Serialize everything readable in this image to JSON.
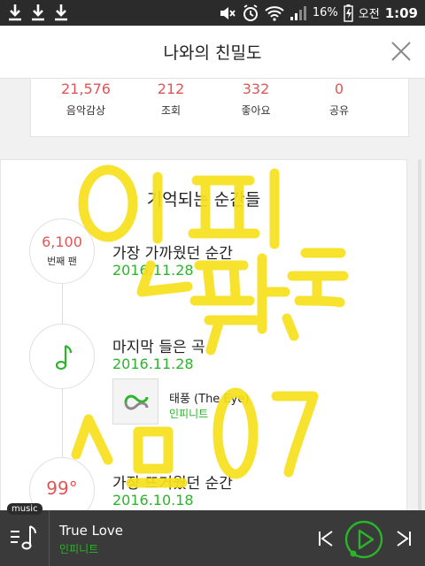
{
  "status_bar": {
    "battery": "16%",
    "ampm": "오전",
    "time": "1:09"
  },
  "header": {
    "title": "나와의 친밀도"
  },
  "stats": [
    {
      "value": "21,576",
      "label": "음악감상"
    },
    {
      "value": "212",
      "label": "조회"
    },
    {
      "value": "332",
      "label": "좋아요"
    },
    {
      "value": "0",
      "label": "공유"
    }
  ],
  "moments": {
    "title": "기억되는 순간들",
    "items": [
      {
        "circle_value": "6,100",
        "circle_sub": "번째 팬",
        "title": "가장 가까웠던 순간",
        "date": "2016.11.28"
      },
      {
        "title": "마지막 들은 곡",
        "date": "2016.11.28",
        "song": "태풍 (The Eye)",
        "artist": "인피니트"
      },
      {
        "circle_value": "99°",
        "title": "가장 뜨거웠던 순간",
        "date": "2016.10.18"
      }
    ]
  },
  "player": {
    "tag": "music",
    "title": "True Love",
    "artist": "인피니트"
  },
  "colors": {
    "accent_green": "#2ab52a",
    "stat_red": "#e25555",
    "doodle_yellow": "#f7e01c"
  }
}
